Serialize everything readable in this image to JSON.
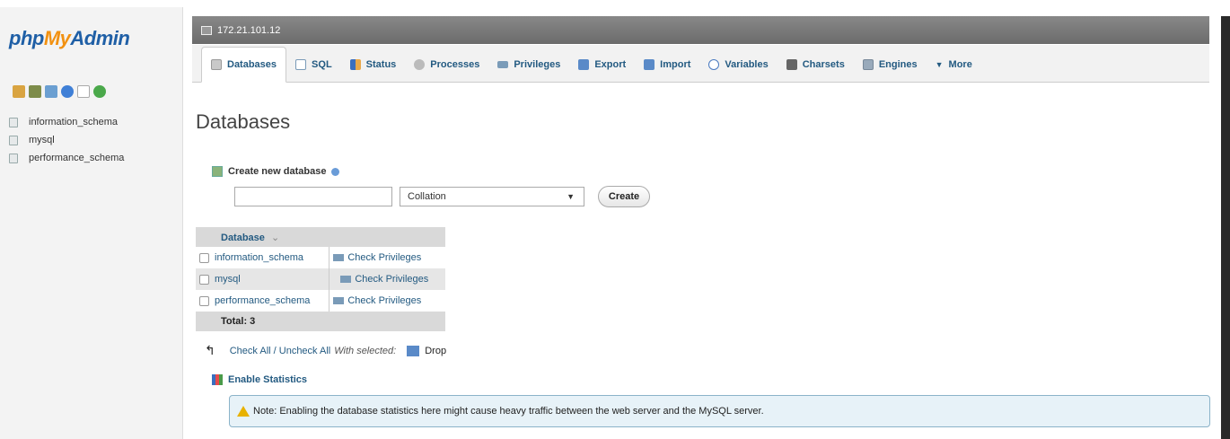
{
  "app": {
    "logo_php": "php",
    "logo_my": "My",
    "logo_admin": "Admin"
  },
  "sidebar": {
    "nav_icons": [
      "home-icon",
      "database-icon",
      "sql-icon",
      "help-icon",
      "docs-icon",
      "reload-icon"
    ],
    "databases": [
      "information_schema",
      "mysql",
      "performance_schema"
    ]
  },
  "server": {
    "host": "172.21.101.12"
  },
  "tabs": [
    {
      "label": "Databases",
      "icon": "database-icon",
      "active": true
    },
    {
      "label": "SQL",
      "icon": "sql-icon"
    },
    {
      "label": "Status",
      "icon": "status-icon"
    },
    {
      "label": "Processes",
      "icon": "processes-icon"
    },
    {
      "label": "Privileges",
      "icon": "privileges-icon"
    },
    {
      "label": "Export",
      "icon": "export-icon"
    },
    {
      "label": "Import",
      "icon": "import-icon"
    },
    {
      "label": "Variables",
      "icon": "variables-icon"
    },
    {
      "label": "Charsets",
      "icon": "charsets-icon"
    },
    {
      "label": "Engines",
      "icon": "engines-icon"
    },
    {
      "label": "More",
      "icon": "caret-down-icon"
    }
  ],
  "main": {
    "title": "Databases",
    "create_label": "Create new database",
    "dbname_value": "",
    "collation": "Collation",
    "create_button": "Create",
    "table": {
      "header": "Database",
      "sort_indicator": "⌄",
      "rows": [
        {
          "name": "information_schema",
          "action": "Check Privileges"
        },
        {
          "name": "mysql",
          "action": "Check Privileges"
        },
        {
          "name": "performance_schema",
          "action": "Check Privileges"
        }
      ],
      "total": "Total: 3"
    },
    "bulk": {
      "check_all": "Check All / Uncheck All",
      "with_selected": "With selected:",
      "drop": "Drop"
    },
    "stats_label": "Enable Statistics",
    "notice": "Note: Enabling the database statistics here might cause heavy traffic between the web server and the MySQL server."
  },
  "colors": {
    "brand_blue": "#1f5fa6",
    "brand_orange": "#f29111",
    "link": "#235a81"
  }
}
